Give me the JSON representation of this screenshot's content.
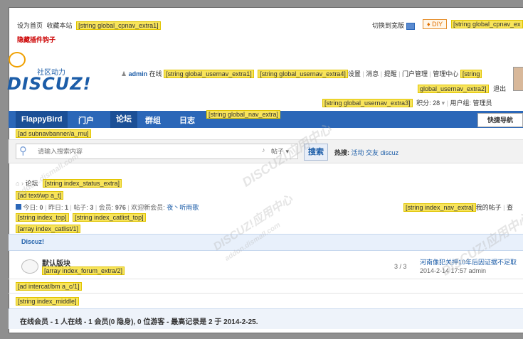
{
  "topbar": {
    "set_home": "设为首页",
    "favorite": "收藏本站",
    "cpnav_extra1": "[string global_cpnav_extra1]",
    "hidden_plugin": "隐藏插件钩子",
    "switch_width": "切换到宽版",
    "diy": "DIY",
    "cpnav_extra2": "[string global_cpnav_ex"
  },
  "logo": {
    "cn": "社区动力",
    "text": "DISCUZ!"
  },
  "usernav": {
    "username": "admin",
    "online": "在线",
    "extra1": "[string global_usernav_extra1]",
    "extra4": "[string global_usernav_extra4]",
    "links": [
      "设置",
      "消息",
      "提醒",
      "门户管理",
      "管理中心"
    ],
    "extra2a": "[string",
    "extra2b": "global_usernav_extra2]",
    "logout": "退出",
    "extra3": "[string global_usernav_extra3]",
    "points": "积分: 28",
    "group": "用户组: 管理员"
  },
  "nav": {
    "items": [
      "FlappyBird",
      "门户",
      "论坛",
      "群组",
      "日志"
    ],
    "extra": "[string global_nav_extra]",
    "quick": "快捷导航"
  },
  "ads": {
    "subnav": "[ad subnavbanner/a_mu]",
    "text": "[ad text/wp a_t]",
    "intercat": "[ad intercat/bm a_c/1]"
  },
  "search": {
    "placeholder": "请输入搜索内容",
    "type": "帖子",
    "button": "搜索",
    "hot_label": "热搜:",
    "hot_items": [
      "活动",
      "交友",
      "discuz"
    ]
  },
  "breadcrumb": {
    "forum": "论坛",
    "status_extra": "[string index_status_extra]"
  },
  "stats": {
    "today_label": "今日:",
    "today": "0",
    "yesterday_label": "昨日:",
    "yesterday": "1",
    "posts_label": "帖子:",
    "posts": "3",
    "members_label": "会员:",
    "members": "976",
    "welcome": "欢迎新会员:",
    "new_member": "夜丶听雨歌",
    "nav_extra": "[string index_nav_extra]",
    "my_posts": "我的帖子",
    "view_more": "查"
  },
  "strings": {
    "index_top": "[string index_top]",
    "catlist_top": "[string index_catlist_top]",
    "catlist": "[array index_catlist/1]",
    "forum_extra": "[array index_forum_extra/2]",
    "index_middle": "[string index_middle]"
  },
  "board": {
    "category": "Discuz!",
    "forum_name": "默认版块",
    "count": "3 / 3",
    "last_title": "河南像犯关押10年后因证据不足取",
    "last_time": "2014-2-14 17:57 admin"
  },
  "footer": {
    "online_summary": "在线会员 - 1 人在线 - 1 会员(0 隐身), 0 位游客 - 最高记录是 2 于 2014-2-25."
  },
  "watermark": {
    "a": "DISCUZ!应用中心",
    "b": "addon.dismall.com"
  },
  "colors": {
    "nav_bg": "#2b67b8",
    "highlight": "#f8e45a",
    "logo": "#1c5da8"
  }
}
